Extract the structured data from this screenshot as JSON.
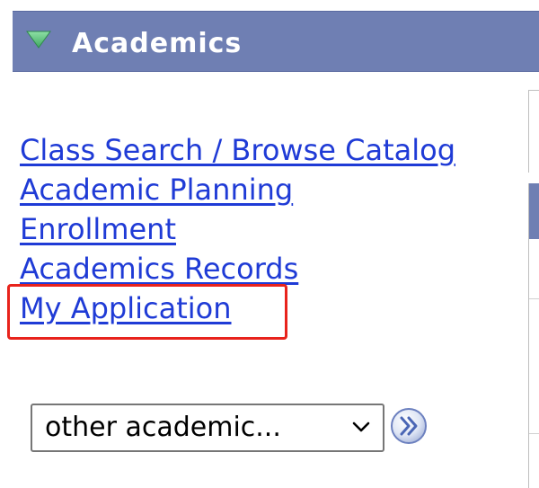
{
  "section": {
    "title": "Academics",
    "toggle_icon": "triangle-down-icon",
    "header_color": "#6f7fb3",
    "toggle_color": "#5ec27a"
  },
  "links": {
    "items": [
      {
        "label": "Class Search / Browse Catalog"
      },
      {
        "label": "Academic Planning"
      },
      {
        "label": "Enrollment"
      },
      {
        "label": "Academics Records"
      },
      {
        "label": "My Application"
      }
    ],
    "link_color": "#1f3bd6"
  },
  "highlight": {
    "color": "#e8231c"
  },
  "dropdown": {
    "selected": "other academic...",
    "icon": "chevron-down-icon"
  },
  "go_button": {
    "icon": "double-chevron-right-icon"
  }
}
